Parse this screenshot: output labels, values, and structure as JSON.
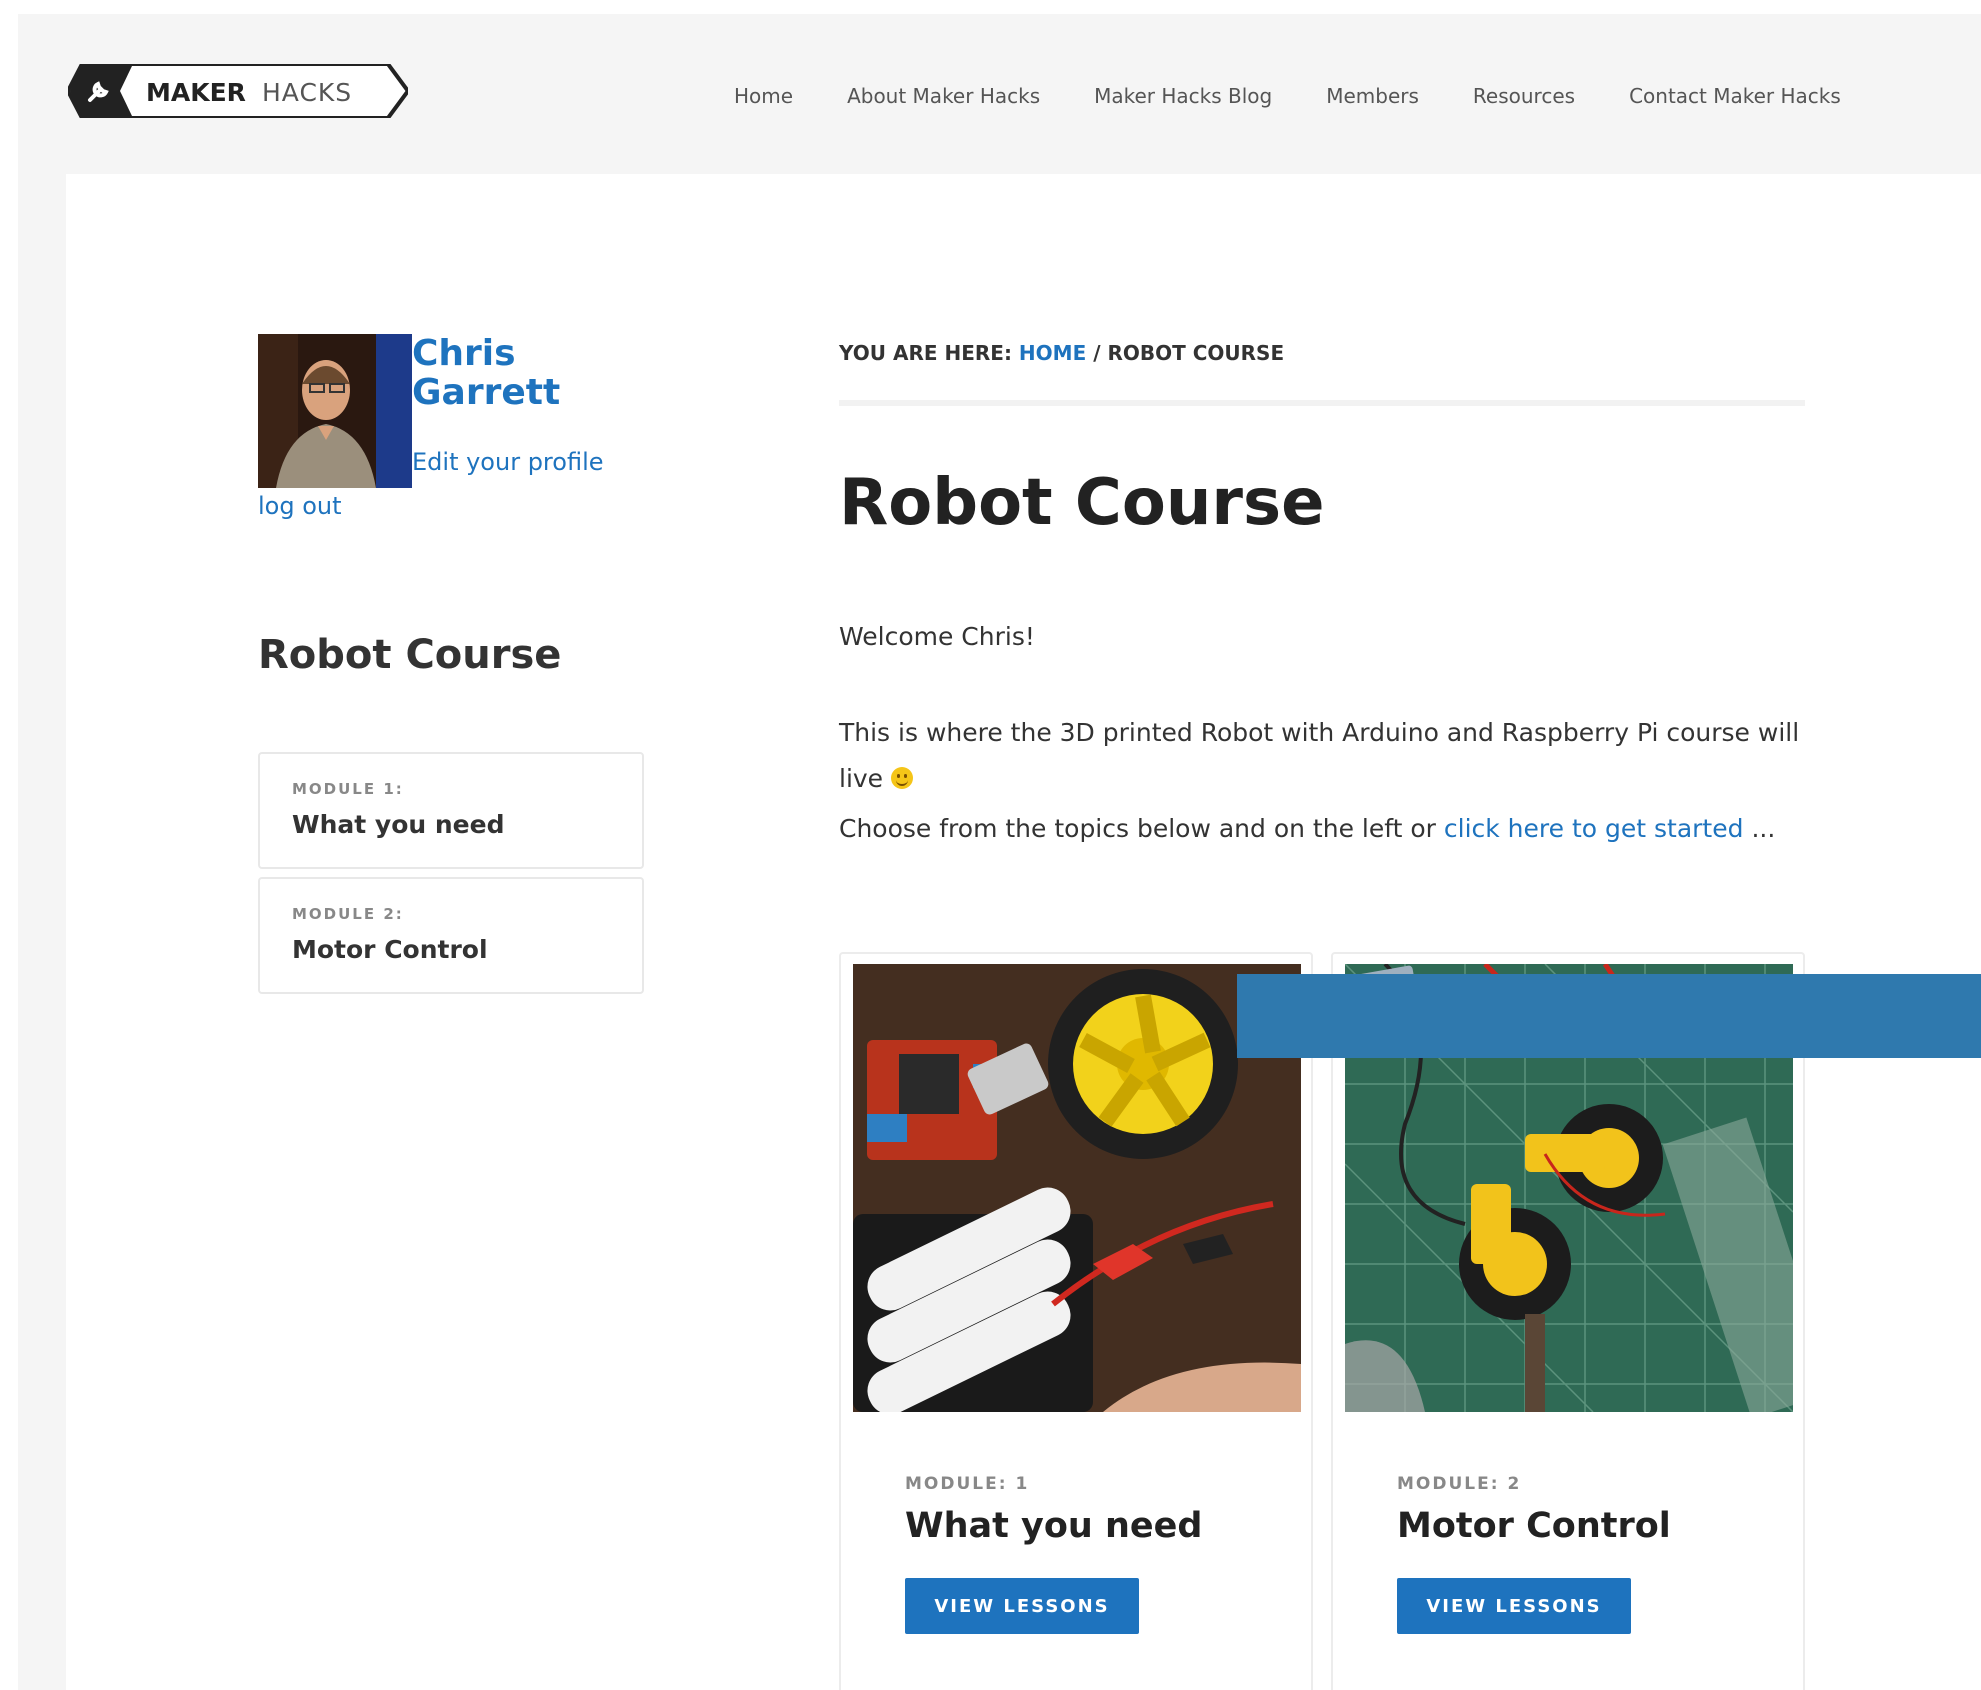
{
  "header": {
    "logo_bold": "MAKER",
    "logo_light": "HACKS",
    "nav": [
      {
        "label": "Home"
      },
      {
        "label": "About Maker Hacks"
      },
      {
        "label": "Maker Hacks Blog"
      },
      {
        "label": "Members"
      },
      {
        "label": "Resources"
      },
      {
        "label": "Contact Maker Hacks"
      }
    ]
  },
  "profile": {
    "name": "Chris Garrett",
    "edit_link": "Edit your profile",
    "logout_link": "log out"
  },
  "sidebar": {
    "title": "Robot Course",
    "modules": [
      {
        "label": "MODULE 1:",
        "title": "What you need"
      },
      {
        "label": "MODULE 2:",
        "title": "Motor Control"
      }
    ]
  },
  "breadcrumb": {
    "prefix": "YOU ARE HERE:",
    "home": "HOME",
    "separator": "/",
    "current": "ROBOT COURSE"
  },
  "main": {
    "title": "Robot Course",
    "welcome": "Welcome Chris!",
    "intro": "This is where the 3D printed Robot with Arduino and Raspberry Pi course will live",
    "choose_text": "Choose from the topics below and on the left or",
    "choose_link": "click here to get started",
    "choose_suffix": "...",
    "cards": [
      {
        "label": "MODULE: 1",
        "title": "What you need",
        "button": "VIEW LESSONS"
      },
      {
        "label": "MODULE: 2",
        "title": "Motor Control",
        "button": "VIEW LESSONS"
      }
    ]
  },
  "colors": {
    "link": "#1e73be",
    "button": "#1e73be",
    "overlay": "#2f79ae"
  }
}
